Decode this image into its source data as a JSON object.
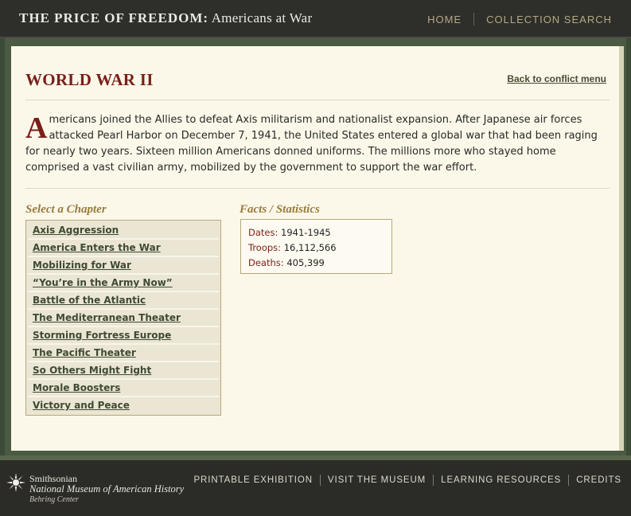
{
  "header": {
    "title_strong": "THE PRICE OF FREEDOM:",
    "title_rest": " Americans at War",
    "nav": [
      "HOME",
      "COLLECTION SEARCH"
    ]
  },
  "page": {
    "title": "WORLD WAR II",
    "back_link": "Back to conflict menu",
    "intro_dropcap": "A",
    "intro_text": "mericans joined the Allies to defeat Axis militarism and nationalist expansion. After Japanese air forces attacked Pearl Harbor on December 7, 1941, the United States entered a global war that had been raging for nearly two years. Sixteen million Americans donned uniforms. The millions more who stayed home comprised a vast civilian army, mobilized by the government to support the war effort."
  },
  "chapters": {
    "heading": "Select a Chapter",
    "items": [
      "Axis Aggression",
      "America Enters the War",
      "Mobilizing for War",
      "“You’re in the Army Now”",
      "Battle of the Atlantic",
      "The Mediterranean Theater",
      "Storming Fortress Europe",
      "The Pacific Theater",
      "So Others Might Fight",
      "Morale Boosters",
      "Victory and Peace"
    ]
  },
  "facts": {
    "heading": "Facts / Statistics",
    "dates_label": "Dates:",
    "dates_value": "1941-1945",
    "troops_label": "Troops:",
    "troops_value": "16,112,566",
    "deaths_label": "Deaths:",
    "deaths_value": "405,399"
  },
  "footer": {
    "org_line1": "Smithsonian",
    "org_line2": "National Museum of American History",
    "org_line3": "Behring Center",
    "nav": [
      "PRINTABLE EXHIBITION",
      "VISIT THE MUSEUM",
      "LEARNING RESOURCES",
      "CREDITS"
    ]
  },
  "colors": {
    "accent": "#7a1f18",
    "gold": "#9a7b3c",
    "header_bg": "#2e2e2a",
    "frame_green": "#4b5a42",
    "content_bg": "#fbf8ea"
  },
  "icons": [
    "smithsonian-sun-icon"
  ]
}
